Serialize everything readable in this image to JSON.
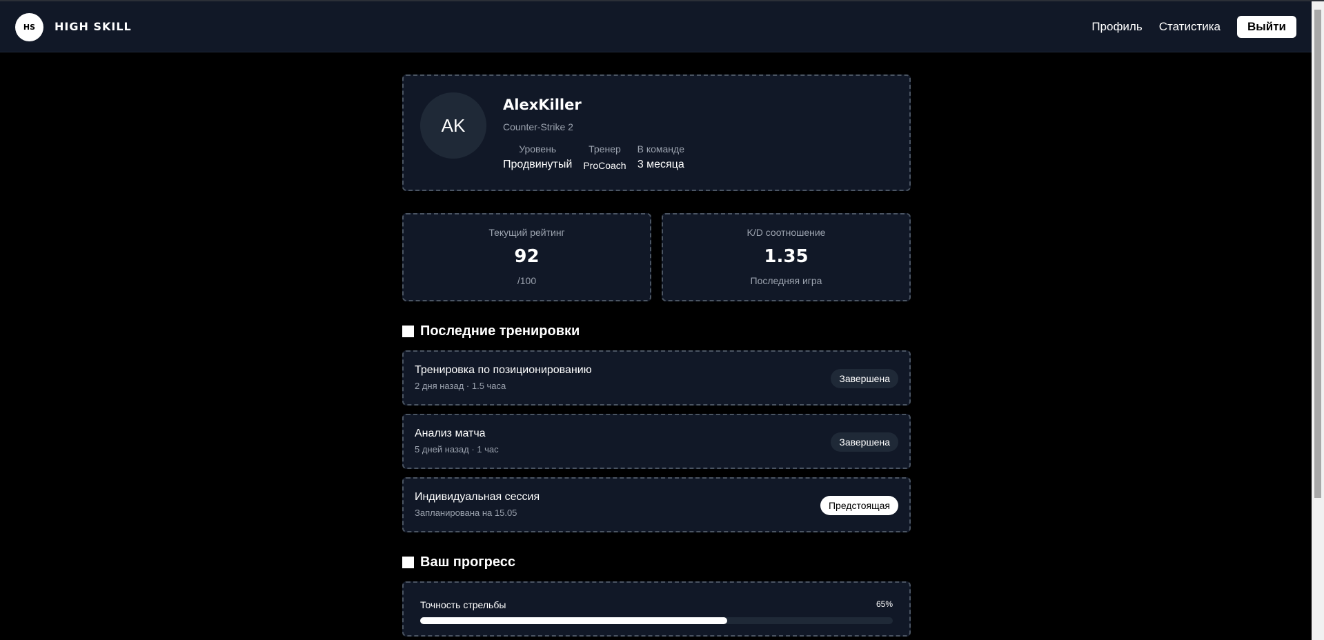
{
  "header": {
    "logo_text": "HS",
    "brand": "HIGH SKILL",
    "nav": [
      "Профиль",
      "Статистика"
    ],
    "logout_label": "Выйти"
  },
  "profile": {
    "initials": "AK",
    "username": "AlexKiller",
    "game": "Counter-Strike 2",
    "meta": [
      {
        "label": "Уровень",
        "value": "Продвинутый"
      },
      {
        "label": "Тренер",
        "value": "ProCoach"
      },
      {
        "label": "В команде",
        "value": "3 месяца"
      }
    ]
  },
  "stats": [
    {
      "label": "Текущий рейтинг",
      "value": "92",
      "sub": "/100"
    },
    {
      "label": "K/D соотношение",
      "value": "1.35",
      "sub": "Последняя игра"
    }
  ],
  "trainings": {
    "title": "Последние тренировки",
    "items": [
      {
        "title": "Тренировка по позиционированию",
        "sub": "2 дня назад · 1.5 часа",
        "status": "Завершена"
      },
      {
        "title": "Анализ матча",
        "sub": "5 дней назад · 1 час",
        "status": "Завершена"
      },
      {
        "title": "Индивидуальная сессия",
        "sub": "Запланирована на 15.05",
        "status": "Предстоящая"
      }
    ]
  },
  "progress": {
    "title": "Ваш прогресс",
    "items": [
      {
        "label": "Точность стрельбы",
        "percent_text": "65%",
        "value": 0.65
      }
    ]
  },
  "colors": {
    "background": "#000000",
    "card": "#111827",
    "accent": "#ffffff"
  }
}
